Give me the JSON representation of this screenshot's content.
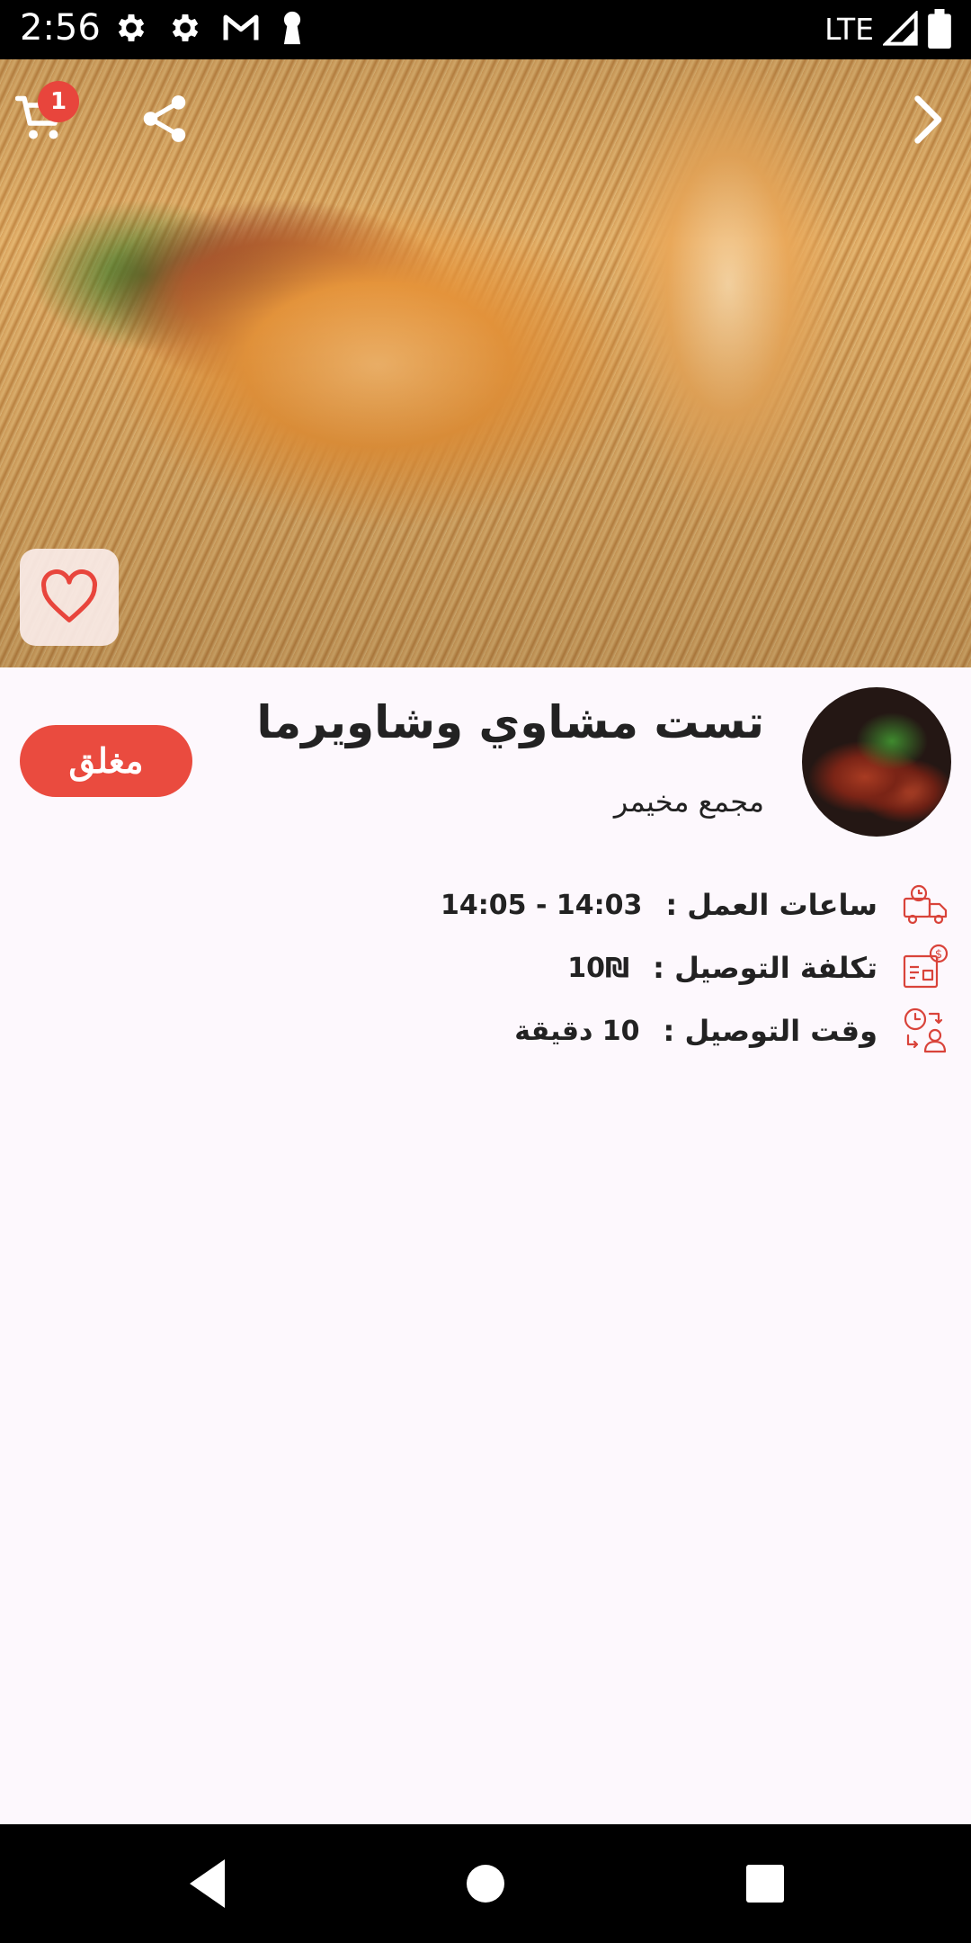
{
  "status_bar": {
    "time": "2:56",
    "network": "LTE",
    "icons": [
      "settings-icon",
      "settings-icon",
      "gmail-icon",
      "keyhole-icon",
      "signal-icon",
      "battery-icon"
    ]
  },
  "hero": {
    "cart_count": "1",
    "icons": [
      "cart-icon",
      "share-icon",
      "chevron-right-icon",
      "heart-icon"
    ]
  },
  "restaurant": {
    "name": "تست مشاوي وشاويرما",
    "location": "مجمع مخيمر",
    "status": "مغلق"
  },
  "info": [
    {
      "label": "ساعات العمل :",
      "value": "14:03 - 14:05",
      "icon": "delivery-truck-icon"
    },
    {
      "label": "تكلفة التوصيل :",
      "value": "10₪",
      "icon": "delivery-cost-icon"
    },
    {
      "label": "وقت التوصيل :",
      "value": "10 دقيقة",
      "icon": "delivery-time-icon"
    }
  ],
  "colors": {
    "accent": "#ea4b3f",
    "icon_red": "#d9433a",
    "text": "#222222",
    "background": "#fdf8fd"
  },
  "nav": {
    "icons": [
      "back-icon",
      "home-icon",
      "recents-icon"
    ]
  }
}
